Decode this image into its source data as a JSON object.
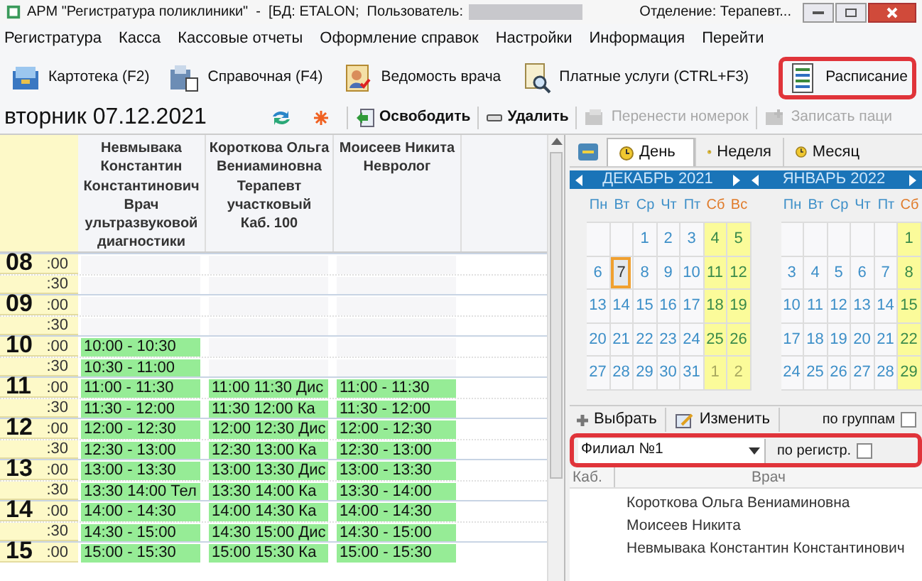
{
  "window": {
    "title": "АРМ \"Регистратура поликлиники\"  -  [БД: ETALON;  Пользователь:",
    "department": "Отделение: Терапевт..."
  },
  "menu": [
    "Регистратура",
    "Касса",
    "Кассовые отчеты",
    "Оформление справок",
    "Настройки",
    "Информация",
    "Перейти"
  ],
  "toolbar": [
    {
      "label": "Картотека (F2)",
      "kind": "cards",
      "highlight": false
    },
    {
      "label": "Справочная (F4)",
      "kind": "info",
      "highlight": false
    },
    {
      "label": "Ведомость врача",
      "kind": "doctor",
      "highlight": false
    },
    {
      "label": "Платные услуги (CTRL+F3)",
      "kind": "paid",
      "highlight": false
    },
    {
      "label": "Расписание",
      "kind": "schedule",
      "highlight": true
    }
  ],
  "datebar": {
    "date": "вторник 07.12.2021",
    "actions": [
      {
        "label": "Освободить",
        "kind": "free",
        "disabled": false
      },
      {
        "label": "Удалить",
        "kind": "delete",
        "disabled": false
      },
      {
        "label": "Перенести номерок",
        "kind": "move",
        "disabled": true
      },
      {
        "label": "Записать паци",
        "kind": "add",
        "disabled": true
      }
    ]
  },
  "schedule": {
    "times": [
      {
        "hour": "08",
        "min": ":00"
      },
      {
        "min": ":30"
      },
      {
        "hour": "09",
        "min": ":00"
      },
      {
        "min": ":30"
      },
      {
        "hour": "10",
        "min": ":00"
      },
      {
        "min": ":30"
      },
      {
        "hour": "11",
        "min": ":00"
      },
      {
        "min": ":30"
      },
      {
        "hour": "12",
        "min": ":00"
      },
      {
        "min": ":30"
      },
      {
        "hour": "13",
        "min": ":00"
      },
      {
        "min": ":30"
      },
      {
        "hour": "14",
        "min": ":00"
      },
      {
        "min": ":30"
      },
      {
        "hour": "15",
        "min": ":00"
      }
    ],
    "doctors": [
      {
        "lines": [
          "Невмывака",
          "Константин",
          "Константинович",
          "Врач",
          "ультразвуковой",
          "диагностики"
        ],
        "slots": [
          "10:00 - 10:30",
          "10:30 - 11:00",
          "11:00 - 11:30",
          "11:30 - 12:00",
          "12:00 - 12:30",
          "12:30 - 13:00",
          "13:00 - 13:30",
          "13:30 14:00 Тел",
          "14:00 - 14:30",
          "14:30 - 15:00",
          "15:00 - 15:30"
        ]
      },
      {
        "lines": [
          "Короткова Ольга",
          "Вениаминовна",
          "Терапевт",
          "участковый",
          "Каб. 100"
        ],
        "slots": [
          "11:00 11:30 Дис",
          "11:30 12:00  Ка",
          "12:00 12:30 Дис",
          "12:30 13:00  Ка",
          "13:00 13:30 Дис",
          "13:30 14:00  Ка",
          "14:00 14:30  Ка",
          "14:30 15:00 Дис",
          "15:00 15:30  Ка"
        ]
      },
      {
        "lines": [
          "Моисеев Никита",
          "Невролог"
        ],
        "slots": [
          "11:00 - 11:30",
          "11:30 - 12:00",
          "12:00 - 12:30",
          "12:30 - 13:00",
          "13:00 - 13:30",
          "13:30 - 14:00",
          "14:00 - 14:30",
          "14:30 - 15:00",
          "15:00 - 15:30"
        ]
      }
    ]
  },
  "view_tabs": [
    {
      "label": "День",
      "selected": true
    },
    {
      "label": "Неделя",
      "selected": false
    },
    {
      "label": "Месяц",
      "selected": false
    }
  ],
  "calendar": {
    "months": [
      {
        "title": "ДЕКАБРЬ 2021",
        "weekdays": [
          "Пн",
          "Вт",
          "Ср",
          "Чт",
          "Пт",
          "Сб",
          "Вс"
        ],
        "weeks": [
          [
            {
              "d": "1",
              "other": false,
              "selected": false
            },
            {
              "d": "2",
              "other": false,
              "selected": false
            },
            {
              "d": "3",
              "other": false,
              "selected": false
            },
            {
              "d": "4",
              "other": false,
              "selected": false
            },
            {
              "d": "5",
              "other": false,
              "selected": false
            }
          ],
          [
            {
              "d": "6",
              "other": false,
              "selected": false
            },
            {
              "d": "7",
              "other": false,
              "selected": true
            },
            {
              "d": "8",
              "other": false,
              "selected": false
            },
            {
              "d": "9",
              "other": false,
              "selected": false
            },
            {
              "d": "10",
              "other": false,
              "selected": false
            },
            {
              "d": "11",
              "other": false,
              "selected": false
            },
            {
              "d": "12",
              "other": false,
              "selected": false
            }
          ],
          [
            {
              "d": "13",
              "other": false,
              "selected": false
            },
            {
              "d": "14",
              "other": false,
              "selected": false
            },
            {
              "d": "15",
              "other": false,
              "selected": false
            },
            {
              "d": "16",
              "other": false,
              "selected": false
            },
            {
              "d": "17",
              "other": false,
              "selected": false
            },
            {
              "d": "18",
              "other": false,
              "selected": false
            },
            {
              "d": "19",
              "other": false,
              "selected": false
            }
          ],
          [
            {
              "d": "20",
              "other": false,
              "selected": false
            },
            {
              "d": "21",
              "other": false,
              "selected": false
            },
            {
              "d": "22",
              "other": false,
              "selected": false
            },
            {
              "d": "23",
              "other": false,
              "selected": false
            },
            {
              "d": "24",
              "other": false,
              "selected": false
            },
            {
              "d": "25",
              "other": false,
              "selected": false
            },
            {
              "d": "26",
              "other": false,
              "selected": false
            }
          ],
          [
            {
              "d": "27",
              "other": false,
              "selected": false
            },
            {
              "d": "28",
              "other": false,
              "selected": false
            },
            {
              "d": "29",
              "other": false,
              "selected": false
            },
            {
              "d": "30",
              "other": false,
              "selected": false
            },
            {
              "d": "31",
              "other": false,
              "selected": false
            },
            {
              "d": "1",
              "other": true,
              "selected": false
            },
            {
              "d": "2",
              "other": true,
              "selected": false
            }
          ]
        ]
      },
      {
        "title": "ЯНВАРЬ 2022",
        "weekdays": [
          "Пн",
          "Вт",
          "Ср",
          "Чт",
          "Пт",
          "Сб"
        ],
        "weeks": [
          [
            {
              "d": "1",
              "other": false,
              "selected": false
            }
          ],
          [
            {
              "d": "3",
              "other": false,
              "selected": false
            },
            {
              "d": "4",
              "other": false,
              "selected": false
            },
            {
              "d": "5",
              "other": false,
              "selected": false
            },
            {
              "d": "6",
              "other": false,
              "selected": false
            },
            {
              "d": "7",
              "other": false,
              "selected": false
            },
            {
              "d": "8",
              "other": false,
              "selected": false
            }
          ],
          [
            {
              "d": "10",
              "other": false,
              "selected": false
            },
            {
              "d": "11",
              "other": false,
              "selected": false
            },
            {
              "d": "12",
              "other": false,
              "selected": false
            },
            {
              "d": "13",
              "other": false,
              "selected": false
            },
            {
              "d": "14",
              "other": false,
              "selected": false
            },
            {
              "d": "15",
              "other": false,
              "selected": false
            }
          ],
          [
            {
              "d": "17",
              "other": false,
              "selected": false
            },
            {
              "d": "18",
              "other": false,
              "selected": false
            },
            {
              "d": "19",
              "other": false,
              "selected": false
            },
            {
              "d": "20",
              "other": false,
              "selected": false
            },
            {
              "d": "21",
              "other": false,
              "selected": false
            },
            {
              "d": "22",
              "other": false,
              "selected": false
            }
          ],
          [
            {
              "d": "24",
              "other": false,
              "selected": false
            },
            {
              "d": "25",
              "other": false,
              "selected": false
            },
            {
              "d": "26",
              "other": false,
              "selected": false
            },
            {
              "d": "27",
              "other": false,
              "selected": false
            },
            {
              "d": "28",
              "other": false,
              "selected": false
            },
            {
              "d": "29",
              "other": false,
              "selected": false
            }
          ]
        ]
      }
    ]
  },
  "doctor_panel": {
    "buttons": [
      {
        "label": "Выбрать",
        "kind": "plus"
      },
      {
        "label": "Изменить",
        "kind": "edit"
      }
    ],
    "group_check": {
      "label": "по группам",
      "checked": false
    },
    "branch": {
      "value": "Филиал №1"
    },
    "reg_check": {
      "label": "по регистр.",
      "checked": false
    },
    "filter_highlight": true,
    "columns": [
      "Каб.",
      "Врач"
    ],
    "rows": [
      "Короткова Ольга Вениаминовна",
      "Моисеев Никита",
      "Невмывака Константин Константинович"
    ]
  }
}
